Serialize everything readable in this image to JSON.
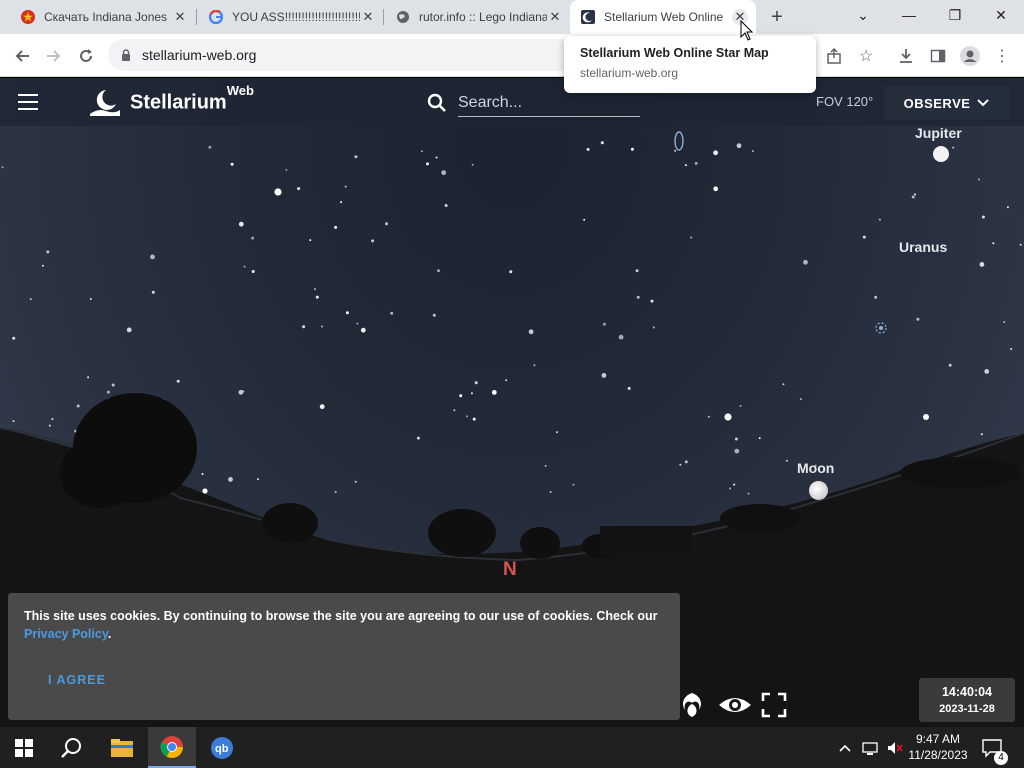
{
  "browser": {
    "tabs": [
      {
        "title": "Скачать Indiana Jones",
        "active": false
      },
      {
        "title": "YOU ASS!!!!!!!!!!!!!!!!!!!!!!!!!",
        "active": false
      },
      {
        "title": "rutor.info :: Lego Indiana",
        "active": false
      },
      {
        "title": "Stellarium Web Online",
        "active": true
      }
    ],
    "url": "stellarium-web.org",
    "tooltip": {
      "title": "Stellarium Web Online Star Map",
      "url": "stellarium-web.org"
    }
  },
  "app": {
    "brand": "Stellarium",
    "brand_sup": "Web",
    "search_placeholder": "Search...",
    "fov": "FOV 120°",
    "observe_label": "OBSERVE"
  },
  "sky_labels": {
    "jupiter": "Jupiter",
    "uranus": "Uranus",
    "moon": "Moon",
    "north": "N"
  },
  "cookie": {
    "text": "This site uses cookies. By continuing to browse the site you are agreeing to our use of cookies. Check our",
    "link": "Privacy Policy",
    "after": ".",
    "agree": "I AGREE"
  },
  "datetime": {
    "time": "14:40:04",
    "date": "2023-11-28"
  },
  "taskbar": {
    "clock_time": "9:47 AM",
    "clock_date": "11/28/2023",
    "notification_count": "4"
  },
  "colors": {
    "accent_link": "#4b9ae0",
    "north_label": "#d9534f"
  }
}
